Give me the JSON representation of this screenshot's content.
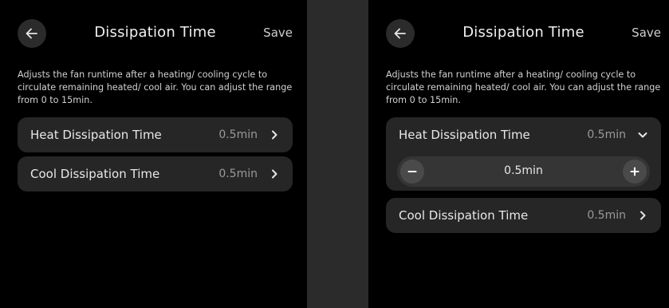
{
  "left": {
    "header": {
      "title": "Dissipation Time",
      "save_label": "Save"
    },
    "description": "Adjusts the fan runtime after a heating/ cooling cycle to circulate remaining heated/ cool air. You can adjust the range from 0 to 15min.",
    "settings": [
      {
        "label": "Heat Dissipation Time",
        "value": "0.5min"
      },
      {
        "label": "Cool Dissipation Time",
        "value": "0.5min"
      }
    ]
  },
  "right": {
    "header": {
      "title": "Dissipation Time",
      "save_label": "Save"
    },
    "description": "Adjusts the fan runtime after a heating/ cooling cycle to circulate remaining heated/ cool air. You can adjust the range from 0 to 15min.",
    "settings": [
      {
        "label": "Heat Dissipation Time",
        "value": "0.5min",
        "expanded": true,
        "stepper_value": "0.5min"
      },
      {
        "label": "Cool Dissipation Time",
        "value": "0.5min"
      }
    ]
  },
  "icons": {
    "back": "arrow-left-icon",
    "collapsed": "chevron-right-icon",
    "expanded": "chevron-down-icon",
    "decrement": "minus-icon",
    "increment": "plus-icon"
  },
  "colors": {
    "background": "#000000",
    "card": "#262626",
    "gutter": "#2b2b2b",
    "value_text": "#9a9a9a"
  }
}
